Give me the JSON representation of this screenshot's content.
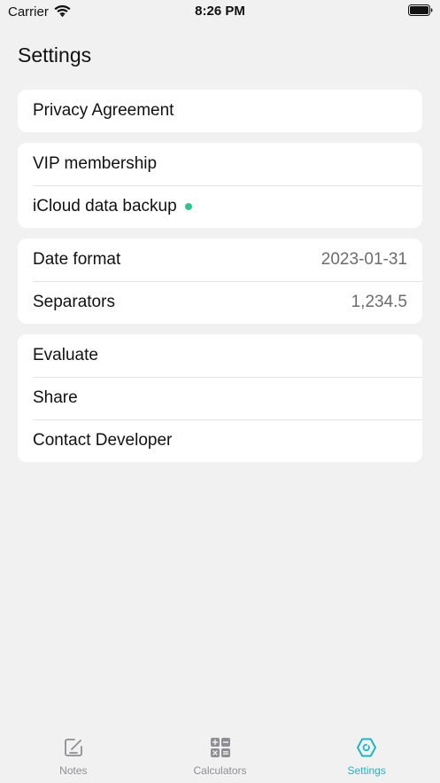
{
  "status_bar": {
    "carrier": "Carrier",
    "time": "8:26 PM"
  },
  "page": {
    "title": "Settings"
  },
  "groups": {
    "privacy": {
      "items": [
        {
          "label": "Privacy Agreement"
        }
      ]
    },
    "account": {
      "items": [
        {
          "label": "VIP membership"
        },
        {
          "label": "iCloud data backup",
          "status_color": "#2fc58a"
        }
      ]
    },
    "format": {
      "items": [
        {
          "label": "Date format",
          "value": "2023-01-31"
        },
        {
          "label": "Separators",
          "value": "1,234.5"
        }
      ]
    },
    "misc": {
      "items": [
        {
          "label": "Evaluate"
        },
        {
          "label": "Share"
        },
        {
          "label": "Contact Developer"
        }
      ]
    }
  },
  "tab_bar": {
    "tabs": [
      {
        "label": "Notes",
        "icon": "notes-icon",
        "active": false
      },
      {
        "label": "Calculators",
        "icon": "calculator-icon",
        "active": false
      },
      {
        "label": "Settings",
        "icon": "settings-icon",
        "active": true
      }
    ],
    "active_color": "#21b5c4",
    "inactive_color": "#8e8e93"
  }
}
